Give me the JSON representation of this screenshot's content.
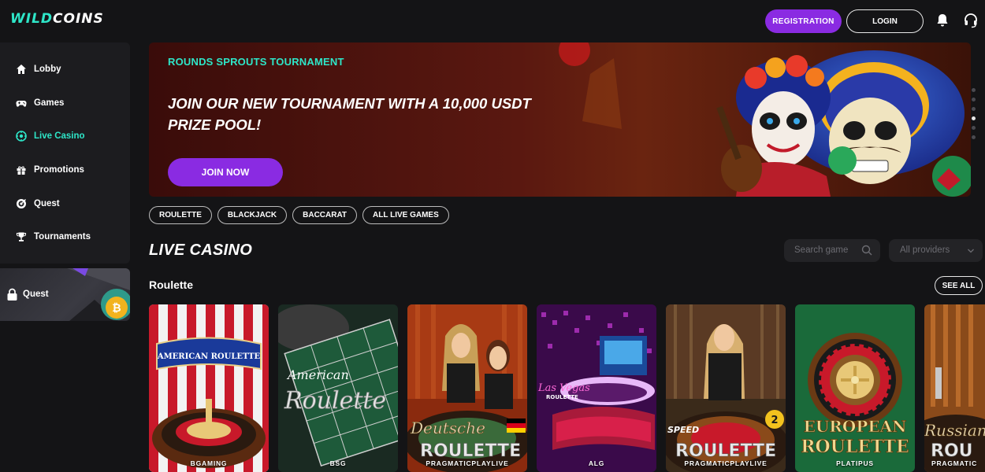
{
  "logo": {
    "part1": "WILD",
    "part2": "COINS"
  },
  "header": {
    "registration_label": "REGISTRATION",
    "login_label": "LOGIN",
    "icons": [
      "bell-icon",
      "headset-icon"
    ]
  },
  "sidebar": {
    "items": [
      {
        "label": "Lobby",
        "icon": "home-icon"
      },
      {
        "label": "Games",
        "icon": "gamepad-icon"
      },
      {
        "label": "Live Casino",
        "icon": "roulette-icon",
        "active": true
      },
      {
        "label": "Promotions",
        "icon": "gift-icon"
      },
      {
        "label": "Quest",
        "icon": "target-icon"
      },
      {
        "label": "Tournaments",
        "icon": "trophy-icon"
      }
    ],
    "quest_card": {
      "label": "Quest"
    }
  },
  "banner": {
    "subtitle": "ROUNDS SPROUTS TOURNAMENT",
    "headline": "JOIN OUR NEW TOURNAMENT WITH A 10,000 USDT PRIZE POOL!",
    "button_label": "JOIN NOW",
    "slides": 6,
    "active_slide": 4
  },
  "filters": [
    "ROULETTE",
    "BLACKJACK",
    "BACCARAT",
    "ALL LIVE GAMES"
  ],
  "main": {
    "title": "LIVE CASINO",
    "search_placeholder": "Search game",
    "providers_placeholder": "All providers"
  },
  "roulette_section": {
    "title": "Roulette",
    "see_all_label": "SEE ALL",
    "games": [
      {
        "provider": "BGAMING",
        "art_text": "AMERICAN ROULETTE"
      },
      {
        "provider": "BSG",
        "art_text": "American Roulette"
      },
      {
        "provider": "PRAGMATICPLAYLIVE",
        "art_text": "Deutsche ROULETTE"
      },
      {
        "provider": "ALG",
        "art_text": "Las Vegas ROULETTE"
      },
      {
        "provider": "PRAGMATICPLAYLIVE",
        "art_text": "SPEED ROULETTE",
        "badge": "2"
      },
      {
        "provider": "PLATIPUS",
        "art_text": "EUROPEAN ROULETTE"
      },
      {
        "provider": "PRAGMATIC",
        "art_text": "Russian ROU"
      }
    ]
  },
  "colors": {
    "accent_teal": "#2ee6c8",
    "accent_purple": "#8a2be2",
    "background": "#141416"
  }
}
